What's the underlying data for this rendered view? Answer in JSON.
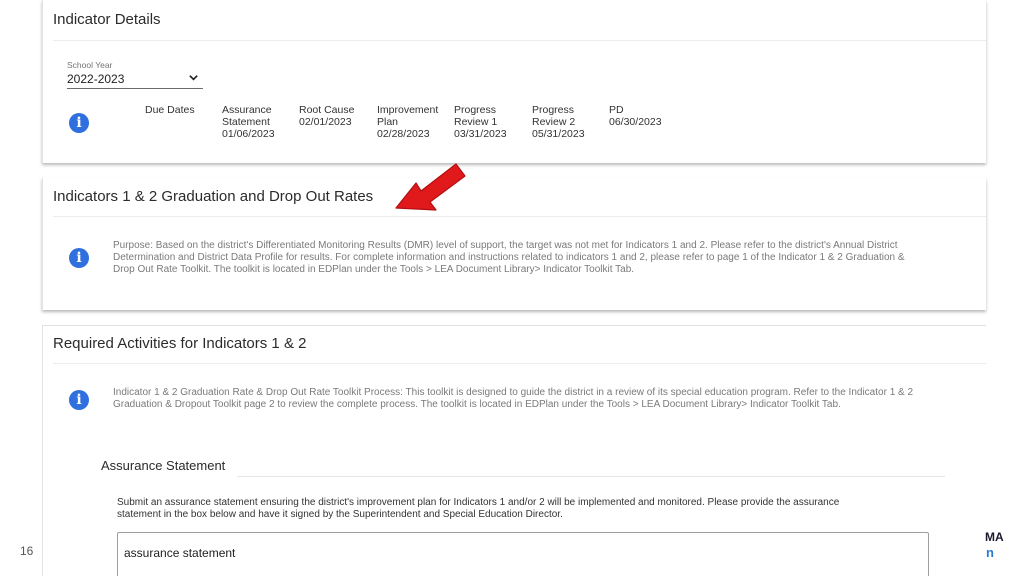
{
  "indicator_details": {
    "title": "Indicator Details",
    "school_year": {
      "label": "School Year",
      "value": "2022-2023"
    },
    "due_dates_label": "Due Dates",
    "due_dates": [
      {
        "lines": [
          "Assurance",
          "Statement",
          "01/06/2023"
        ]
      },
      {
        "lines": [
          "Root Cause",
          "02/01/2023"
        ]
      },
      {
        "lines": [
          "Improvement",
          "Plan",
          "02/28/2023"
        ]
      },
      {
        "lines": [
          "Progress",
          "Review 1",
          "03/31/2023"
        ]
      },
      {
        "lines": [
          "Progress",
          "Review 2",
          "05/31/2023"
        ]
      },
      {
        "lines": [
          "PD",
          "06/30/2023"
        ]
      }
    ]
  },
  "graduation": {
    "title": "Indicators 1 & 2 Graduation and Drop Out Rates",
    "purpose_lines": [
      "Purpose: Based on the district's Differentiated Monitoring Results (DMR) level of support, the target was not met for Indicators 1 and 2. Please refer to the district's Annual District",
      "Determination and District Data Profile for results. For complete information and instructions related to indicators 1 and 2, please refer to page 1 of the Indicator 1 & 2 Graduation &",
      "Drop Out Rate Toolkit. The toolkit is located in EDPlan under the Tools > LEA Document Library> Indicator Toolkit Tab."
    ]
  },
  "required_activities": {
    "title": "Required Activities for Indicators 1 & 2",
    "process_lines": [
      "Indicator 1 & 2 Graduation Rate & Drop Out Rate Toolkit Process: This toolkit is designed to guide the district in a review of its special education program. Refer to the Indicator 1 & 2",
      "Graduation & Dropout Toolkit page 2 to review the complete process. The toolkit is located in EDPlan under the Tools > LEA Document Library> Indicator Toolkit Tab."
    ],
    "assurance": {
      "title": "Assurance Statement",
      "instruction_lines": [
        "Submit an assurance statement ensuring the district's improvement plan for Indicators 1 and/or 2 will be implemented and monitored. Please provide the assurance",
        "statement in the box below and have it signed by the Superintendent and Special Education Director."
      ],
      "textbox_value": "assurance statement"
    }
  },
  "footer": {
    "page_number": "16",
    "logo_top": "MA",
    "logo_bottom": "n"
  },
  "colors": {
    "info_icon": "#2f6fde",
    "arrow": "#e0191b"
  },
  "icons": {
    "info": "info-icon",
    "dropdown": "chevron-down-icon",
    "callout": "red-arrow-icon"
  }
}
